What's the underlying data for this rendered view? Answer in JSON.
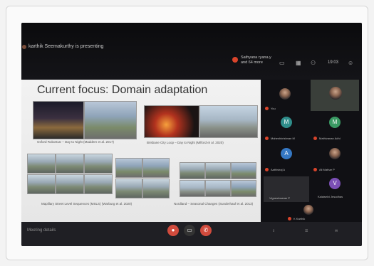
{
  "meeting": {
    "presenter_text": "karthik Seemakurthy is presenting",
    "sharing_text": "Sathyana ryana.y and 64 more",
    "time": "19:03",
    "toolbar_label": "Meeting details"
  },
  "slide": {
    "title": "Current focus: Domain adaptation",
    "captions": {
      "c1": "Oxford RobotCar – Day to Night (Maddern et al. 2017)",
      "c2": "Brisbane City Loop – Day to Night (Milford et al. 2020)",
      "c3": "Mapillary Street Level Sequences (MSLS) (Warburg et al. 2020)",
      "c4": "Nordland – Seasonal Changes (Sunderhauf et al. 2013)"
    }
  },
  "participants": [
    {
      "name": "You",
      "initial": ""
    },
    {
      "name": "Maheshkrishnan M",
      "initial": "M",
      "color": "#2f8d8a"
    },
    {
      "name": "Mathivanan Adhi",
      "initial": "M",
      "color": "#3a9a63"
    },
    {
      "name": "Aathisiraj A",
      "initial": "A",
      "color": "#3578c4"
    },
    {
      "name": "Ali Mathar P",
      "initial": ""
    },
    {
      "name": "Vigneshwaran P",
      "initial": ""
    },
    {
      "name": "Kalaiselvi Jesudhas",
      "initial": "V",
      "color": "#7b4fb5"
    },
    {
      "name": "K Karthik",
      "initial": ""
    }
  ],
  "colors": {
    "accent": "#d14b3d",
    "slide_bg": "#eeeeee",
    "screen_bg": "#1b1b1f"
  }
}
